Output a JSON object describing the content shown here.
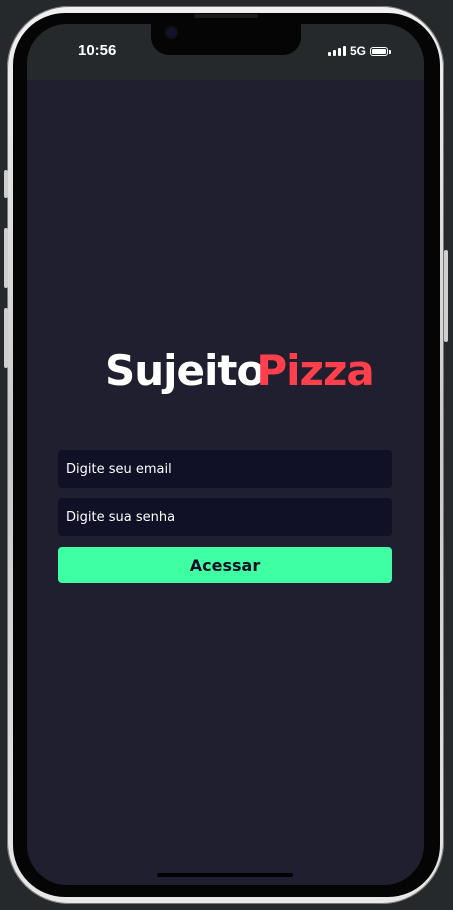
{
  "status_bar": {
    "time": "10:56",
    "network": "5G",
    "icons": [
      "signal-icon",
      "battery-icon"
    ]
  },
  "brand": {
    "part1": "Sujeito",
    "part2": "Pizza",
    "colors": {
      "part1": "#ffffff",
      "part2": "#ff3f4b"
    }
  },
  "login_form": {
    "email_placeholder": "Digite seu email",
    "email_value": "",
    "password_placeholder": "Digite sua senha",
    "password_value": "",
    "submit_label": "Acessar"
  },
  "colors": {
    "background": "#1f1f2f",
    "input_background": "#101026",
    "button_background": "#3fffa3",
    "status_bar": "#25292b"
  }
}
